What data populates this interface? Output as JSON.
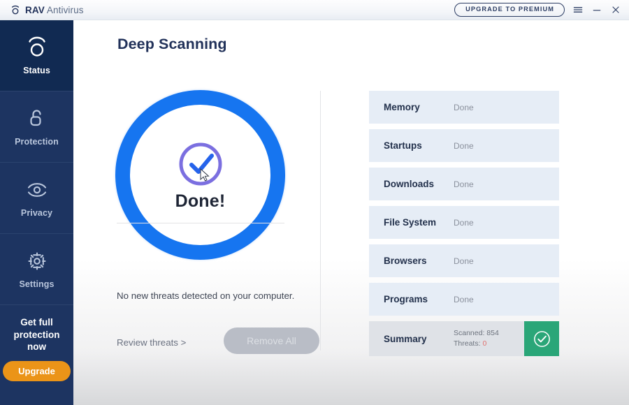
{
  "titlebar": {
    "brand_bold": "RAV",
    "brand_light": "Antivirus",
    "logo_icon": "rav-logo-mark",
    "upgrade_label": "UPGRADE TO PREMIUM",
    "menu_icon": "hamburger-menu-icon",
    "minimize_icon": "minimize-icon",
    "close_icon": "close-icon"
  },
  "sidebar": {
    "items": [
      {
        "label": "Status",
        "icon": "status-circle-icon",
        "active": true
      },
      {
        "label": "Protection",
        "icon": "open-padlock-icon",
        "active": false
      },
      {
        "label": "Privacy",
        "icon": "eye-icon",
        "active": false
      },
      {
        "label": "Settings",
        "icon": "gear-icon",
        "active": false
      }
    ],
    "promo_text": "Get full protection now",
    "promo_button": "Upgrade"
  },
  "main": {
    "page_title": "Deep Scanning",
    "scan_status": "Done!",
    "scan_icon": "check-circle-icon",
    "no_threats_text": "No new threats detected on your computer.",
    "review_link": "Review threats >",
    "remove_button": "Remove All"
  },
  "scan_list": {
    "rows": [
      {
        "label": "Memory",
        "status": "Done"
      },
      {
        "label": "Startups",
        "status": "Done"
      },
      {
        "label": "Downloads",
        "status": "Done"
      },
      {
        "label": "File System",
        "status": "Done"
      },
      {
        "label": "Browsers",
        "status": "Done"
      },
      {
        "label": "Programs",
        "status": "Done"
      }
    ],
    "summary": {
      "label": "Summary",
      "scanned_label": "Scanned: 854",
      "threats_label": "Threats: ",
      "threats_value": "0",
      "badge_icon": "check-circle-icon"
    }
  },
  "colors": {
    "brand_navy": "#1d3461",
    "accent_blue": "#1675f0",
    "upgrade_orange": "#eb9418",
    "success_green": "#2aa678",
    "threat_red": "#e0716f"
  }
}
